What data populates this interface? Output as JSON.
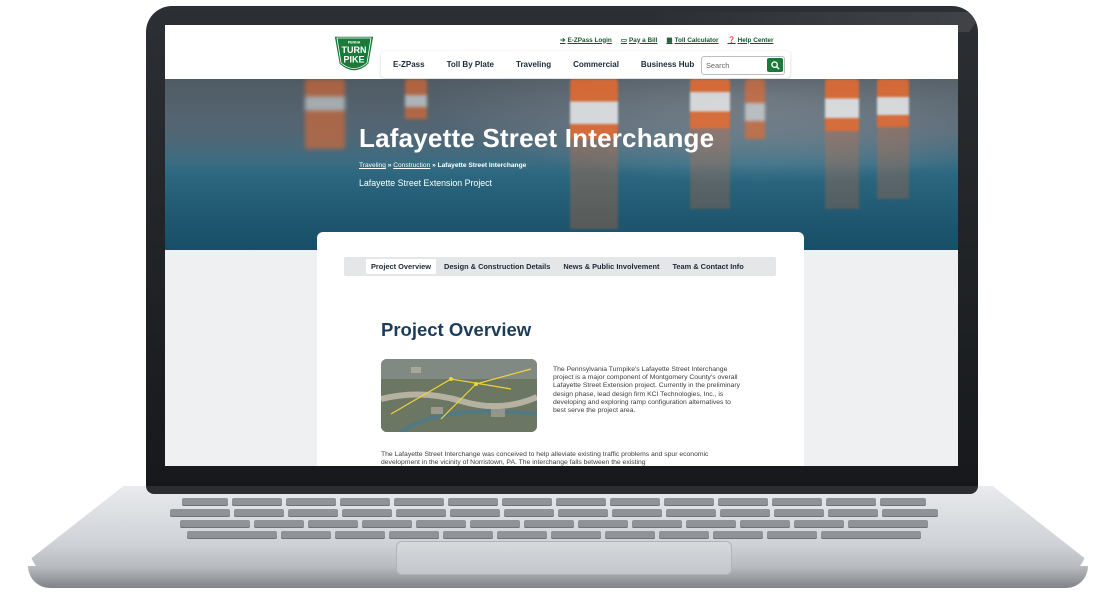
{
  "utility_links": [
    {
      "icon": "login-icon",
      "label": "E-ZPass Login"
    },
    {
      "icon": "card-icon",
      "label": "Pay a Bill"
    },
    {
      "icon": "calculator-icon",
      "label": "Toll Calculator"
    },
    {
      "icon": "help-icon",
      "label": "Help Center"
    }
  ],
  "logo": {
    "top": "PENNA",
    "line1": "TURN",
    "line2": "PIKE"
  },
  "nav": {
    "items": [
      "E-ZPass",
      "Toll By Plate",
      "Traveling",
      "Commercial",
      "Business Hub"
    ],
    "search_placeholder": "Search"
  },
  "hero": {
    "title": "Lafayette Street Interchange",
    "breadcrumb": {
      "crumb1": "Traveling",
      "sep": " » ",
      "crumb2": "Construction",
      "current": "Lafayette Street Interchange"
    },
    "subtitle": "Lafayette Street Extension Project"
  },
  "tabs": [
    "Project Overview",
    "Design & Construction Details",
    "News & Public Involvement",
    "Team & Contact Info"
  ],
  "overview": {
    "heading": "Project Overview",
    "para1": "The Pennsylvania Turnpike's Lafayette Street Interchange project is a major component of Montgomery County's overall Lafayette Street Extension project. Currently in the preliminary design phase, lead design firm KCI Technologies, Inc., is developing and exploring ramp configuration alternatives to best serve the project area.",
    "para2": "The Lafayette Street Interchange was conceived to help alleviate existing traffic problems and spur economic development in the vicinity of Norristown, PA. The interchange falls between the existing"
  },
  "colors": {
    "brand_green": "#1a7a3a",
    "heading_navy": "#1c3d5a",
    "cone_orange": "#f06a2a"
  }
}
